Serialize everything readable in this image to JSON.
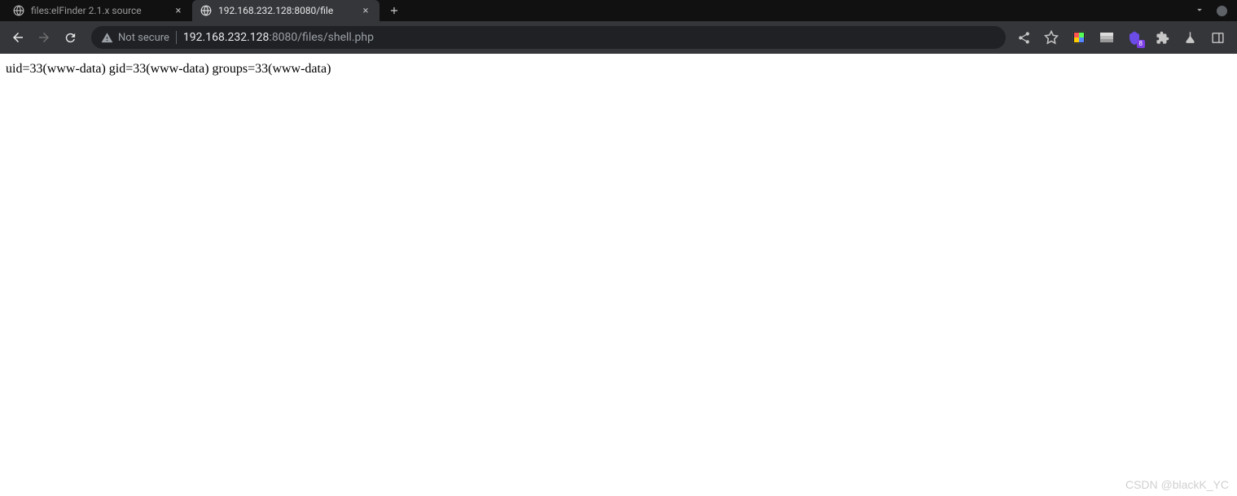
{
  "tabs": [
    {
      "title": "files:elFinder 2.1.x source",
      "active": false
    },
    {
      "title": "192.168.232.128:8080/file",
      "active": true
    }
  ],
  "address": {
    "security_label": "Not secure",
    "host": "192.168.232.128",
    "port_path": ":8080/files/shell.php"
  },
  "extension_badge": "8",
  "page": {
    "output": "uid=33(www-data) gid=33(www-data) groups=33(www-data)"
  },
  "watermark": "CSDN @blackK_YC"
}
